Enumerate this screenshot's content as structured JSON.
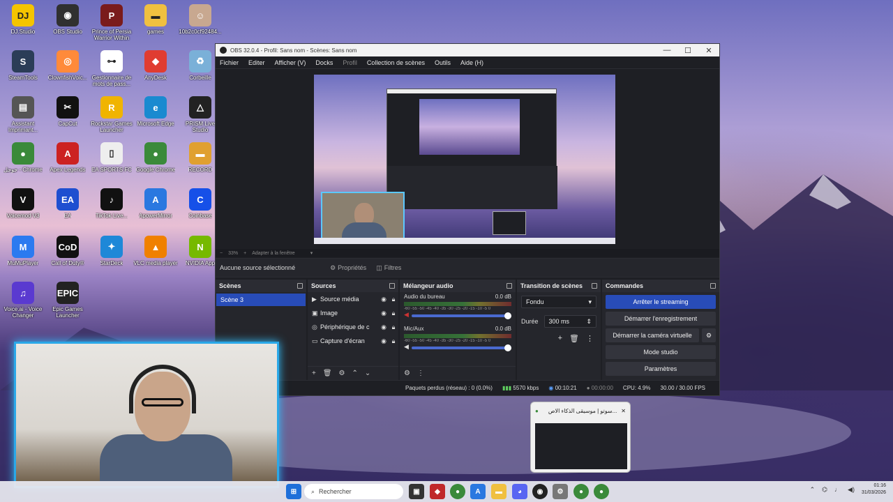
{
  "desktop": {
    "icons": [
      {
        "label": "DJ.Studio",
        "color": "#f5c400",
        "glyph": "DJ"
      },
      {
        "label": "OBS Studio",
        "color": "#303030",
        "glyph": "◉"
      },
      {
        "label": "Prince of Persia Warrior Within",
        "color": "#7a1b1b",
        "glyph": "P"
      },
      {
        "label": "games",
        "color": "#f0c040",
        "glyph": "▬"
      },
      {
        "label": "10b2c0cf92484...",
        "color": "#c8a890",
        "glyph": "☺"
      },
      {
        "label": "SteamTools",
        "color": "#2b3d57",
        "glyph": "S"
      },
      {
        "label": "ClownfishVoic...",
        "color": "#ff8a3a",
        "glyph": "◎"
      },
      {
        "label": "Gestionnaire de mots de pass...",
        "color": "#ffffff",
        "glyph": "⊶"
      },
      {
        "label": "AnyDesk",
        "color": "#e03c31",
        "glyph": "◆"
      },
      {
        "label": "Corbeille",
        "color": "#7ab0d8",
        "glyph": "♻"
      },
      {
        "label": "Assistant Imprimant...",
        "color": "#555",
        "glyph": "▤"
      },
      {
        "label": "CapCut",
        "color": "#111",
        "glyph": "✂"
      },
      {
        "label": "Rockstar Games Launcher",
        "color": "#f0b400",
        "glyph": "R"
      },
      {
        "label": "Microsoft Edge",
        "color": "#1a8ad0",
        "glyph": "e"
      },
      {
        "label": "PRISM Live Studio",
        "color": "#222",
        "glyph": "△"
      },
      {
        "label": "جوجل - Chrome",
        "color": "#3a8a3a",
        "glyph": "●"
      },
      {
        "label": "Apex Legends",
        "color": "#cc2222",
        "glyph": "A"
      },
      {
        "label": "EA SPORTS FC",
        "color": "#eeeeee",
        "glyph": "▯"
      },
      {
        "label": "Google Chrome",
        "color": "#3a8a3a",
        "glyph": "●"
      },
      {
        "label": "RECORD",
        "color": "#e0a030",
        "glyph": "▬"
      },
      {
        "label": "Voicemod V3",
        "color": "#111",
        "glyph": "V"
      },
      {
        "label": "EA",
        "color": "#1e4fd0",
        "glyph": "EA"
      },
      {
        "label": "TikTok Live...",
        "color": "#111",
        "glyph": "♪"
      },
      {
        "label": "ApowerMirror",
        "color": "#2a78e0",
        "glyph": "A"
      },
      {
        "label": "Coinbase",
        "color": "#1650e8",
        "glyph": "C"
      },
      {
        "label": "MuMuPlayer",
        "color": "#2b7af0",
        "glyph": "M"
      },
      {
        "label": "Call of Duty®",
        "color": "#111",
        "glyph": "CoD"
      },
      {
        "label": "StarDeck",
        "color": "#1e88d8",
        "glyph": "✦"
      },
      {
        "label": "VLC media player",
        "color": "#f08000",
        "glyph": "▲"
      },
      {
        "label": "NVIDIA App",
        "color": "#76b900",
        "glyph": "N"
      },
      {
        "label": "Voice.ai - Voice Changer",
        "color": "#5a3ad0",
        "glyph": "♫"
      },
      {
        "label": "Epic Games Launcher",
        "color": "#222",
        "glyph": "EPIC"
      }
    ]
  },
  "obs": {
    "title": "OBS 32.0.4 - Profil: Sans nom - Scènes: Sans nom",
    "menu": [
      "Fichier",
      "Editer",
      "Afficher (V)",
      "Docks",
      "Profil",
      "Collection de scènes",
      "Outils",
      "Aide (H)"
    ],
    "zoom": "33%",
    "fit_label": "Adapter à la fenêtre",
    "no_source": "Aucune source sélectionné",
    "properties": "Propriétés",
    "filters": "Filtres",
    "scenes": {
      "title": "Scènes",
      "items": [
        "Scène 3"
      ]
    },
    "sources": {
      "title": "Sources",
      "items": [
        {
          "icon": "▶",
          "name": "Source média"
        },
        {
          "icon": "▣",
          "name": "Image"
        },
        {
          "icon": "◎",
          "name": "Périphérique de c"
        },
        {
          "icon": "▭",
          "name": "Capture d'écran"
        }
      ]
    },
    "mixer": {
      "title": "Mélangeur audio",
      "channels": [
        {
          "name": "Audio du bureau",
          "db": "0.0 dB"
        },
        {
          "name": "Mic/Aux",
          "db": "0.0 dB"
        }
      ],
      "ticks": "-60 -55 -50 -45 -40 -35 -30 -25 -20 -15 -10 -5 0"
    },
    "transitions": {
      "title": "Transition de scènes",
      "type": "Fondu",
      "duration_label": "Durée",
      "duration_value": "300 ms"
    },
    "commands": {
      "title": "Commandes",
      "stop_stream": "Arrêter le streaming",
      "start_record": "Démarrer l'enregistrement",
      "start_vcam": "Démarrer la caméra virtuelle",
      "studio_mode": "Mode studio",
      "settings": "Paramètres"
    },
    "status": {
      "dropped": "Paquets perdus (réseau) : 0 (0.0%)",
      "bitrate": "5570 kbps",
      "stream_time": "00:10:21",
      "rec_time": "00:00:00",
      "cpu": "CPU: 4.9%",
      "fps": "30.00 / 30.00 FPS"
    }
  },
  "notification": {
    "title": "سوتو | موسيقى الذكاء الاص..."
  },
  "taskbar": {
    "search_placeholder": "Rechercher",
    "time": "01:16",
    "date": "31/03/2026"
  }
}
